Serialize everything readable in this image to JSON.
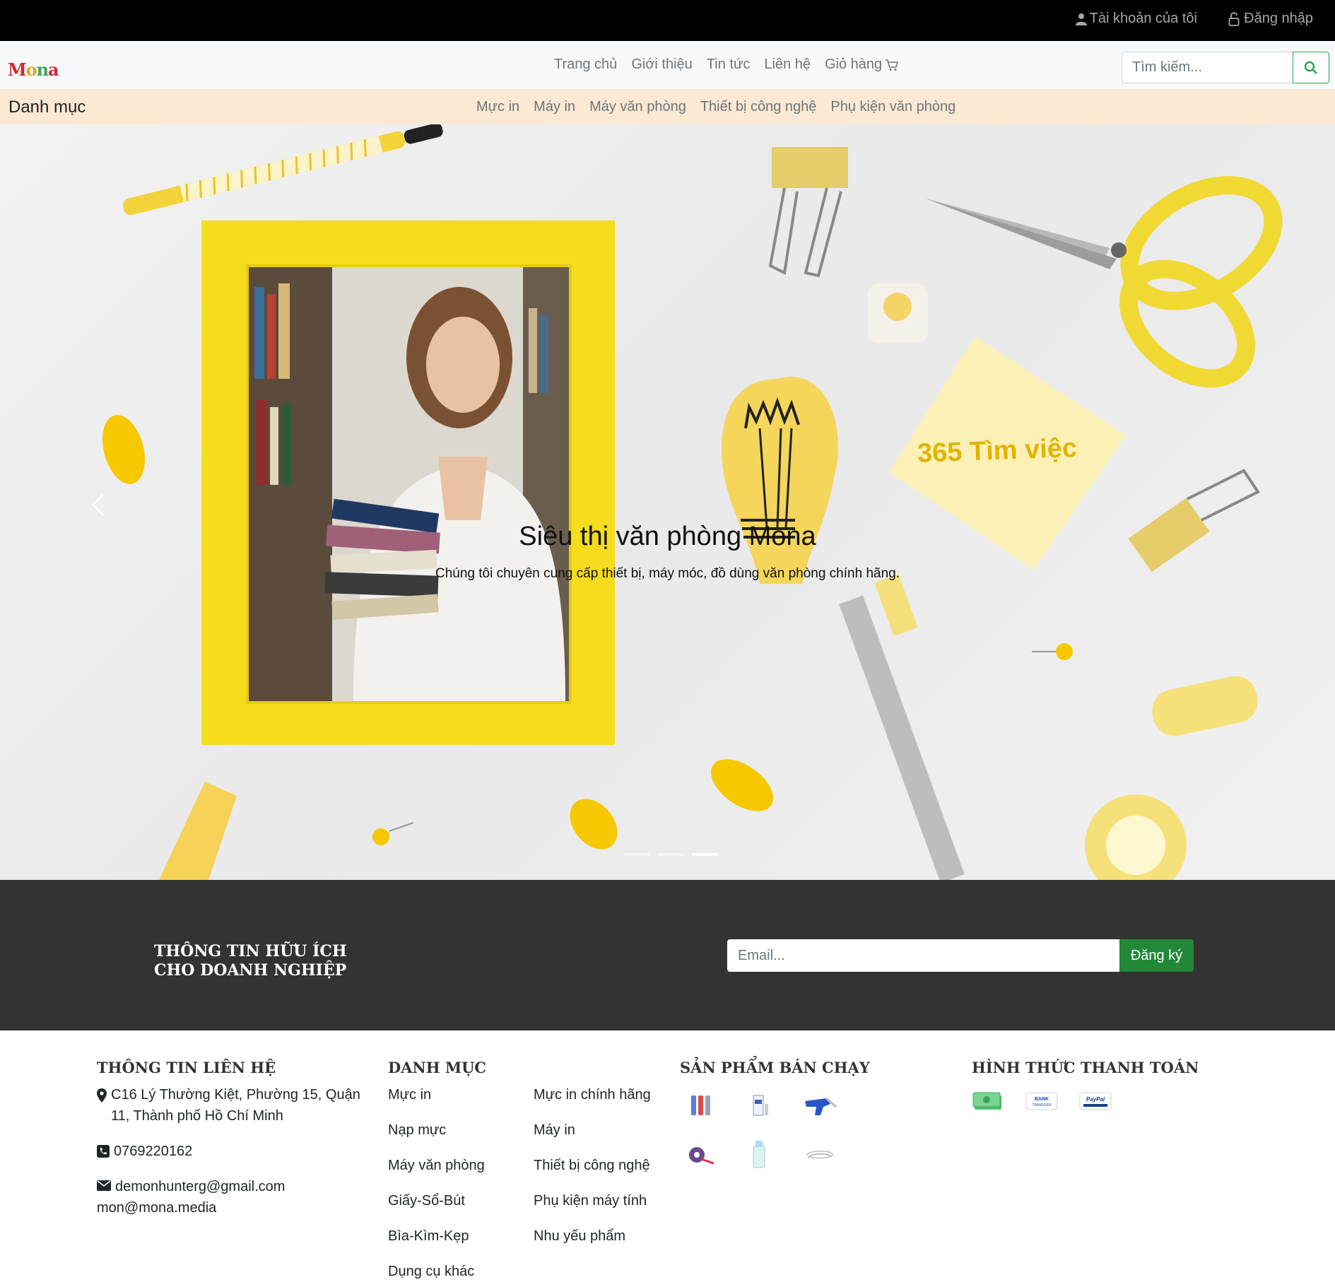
{
  "topbar": {
    "account_label": "Tài khoản của tôi",
    "login_label": "Đăng nhập"
  },
  "navbar": {
    "logo_text": "Mona",
    "menu": [
      "Trang chủ",
      "Giới thiệu",
      "Tin tức",
      "Liên hệ",
      "Giỏ hàng"
    ],
    "search_placeholder": "Tìm kiếm..."
  },
  "category_bar": {
    "title": "Danh mục",
    "items": [
      "Mực in",
      "Máy in",
      "Máy văn phòng",
      "Thiết bị công nghệ",
      "Phụ kiện văn phòng"
    ]
  },
  "hero": {
    "title": "Siêu thị văn phòng Mona",
    "subtitle": "Chúng tôi chuyên cung cấp thiết bị, máy móc, đồ dùng văn phòng chính hãng.",
    "watermark": "365 Tìm việc",
    "slide_count": 3,
    "active_slide": 3
  },
  "newsletter": {
    "title_line1": "THÔNG TIN HỮU ÍCH",
    "title_line2": "CHO DOANH NGHIỆP",
    "email_placeholder": "Email...",
    "button_label": "Đăng ký"
  },
  "footer": {
    "contact": {
      "heading": "THÔNG TIN LIÊN HỆ",
      "address": "C16 Lý Thường Kiệt, Phường 15, Quận 11, Thành phố Hồ Chí Minh",
      "phone": "0769220162",
      "email1": "demonhunterg@gmail.com",
      "email2": "mon@mona.media"
    },
    "categories": {
      "heading": "DANH MỤC",
      "col1": [
        "Mực in",
        "Nạp mực",
        "Máy văn phòng",
        "Giấy-Sổ-Bút",
        "Bìa-Kìm-Kẹp",
        "Dụng cụ khác"
      ],
      "col2": [
        "Mực in chính hãng",
        "Máy in",
        "Thiết bị công nghệ",
        "Phụ kiện máy tính",
        "Nhu yếu phẩm"
      ]
    },
    "bestsellers": {
      "heading": "SẢN PHẨM BÁN CHẠY"
    },
    "payment": {
      "heading": "HÌNH THỨC THANH TOÁN",
      "bank_text": "BANK TRANSFER",
      "paypal_text": "PayPal"
    }
  }
}
